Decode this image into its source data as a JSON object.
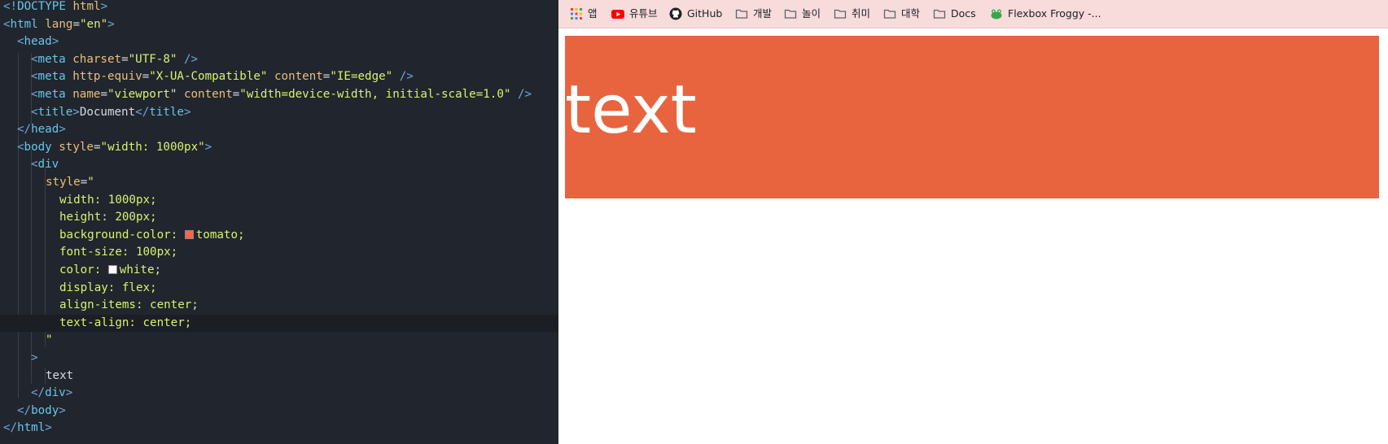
{
  "editor": {
    "lines": [
      "<!DOCTYPE html>",
      "<html lang=\"en\">",
      "<head>",
      "<meta charset=\"UTF-8\" />",
      "<meta http-equiv=\"X-UA-Compatible\" content=\"IE=edge\" />",
      "<meta name=\"viewport\" content=\"width=device-width, initial-scale=1.0\" />",
      "<title>Document</title>",
      "</head>",
      "<body style=\"width: 1000px\">",
      "<div",
      "style=\"",
      "width: 1000px;",
      "height: 200px;",
      "background-color: tomato;",
      "font-size: 100px;",
      "color: white;",
      "display: flex;",
      "align-items: center;",
      "text-align: center;",
      "\"",
      ">",
      "text",
      "</div>",
      "</body>",
      "</html>"
    ],
    "swatches": {
      "tomato": "#ff6347",
      "white": "#ffffff"
    }
  },
  "browser": {
    "bookmarks": [
      {
        "label": "앱",
        "icon": "apps-grid-icon"
      },
      {
        "label": "유튜브",
        "icon": "youtube-icon"
      },
      {
        "label": "GitHub",
        "icon": "github-icon"
      },
      {
        "label": "개발",
        "icon": "folder-icon"
      },
      {
        "label": "놀이",
        "icon": "folder-icon"
      },
      {
        "label": "취미",
        "icon": "folder-icon"
      },
      {
        "label": "대학",
        "icon": "folder-icon"
      },
      {
        "label": "Docs",
        "icon": "folder-icon"
      },
      {
        "label": "Flexbox Froggy -...",
        "icon": "frog-icon"
      }
    ],
    "demo_text": "text",
    "demo_bg": "#e8643f"
  }
}
